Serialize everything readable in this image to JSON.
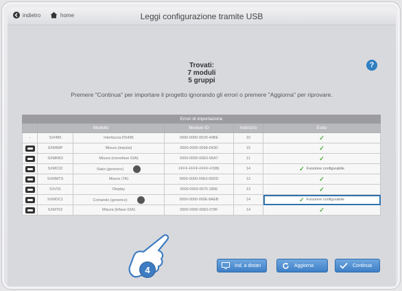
{
  "header": {
    "back_label": "indietro",
    "home_label": "home",
    "title": "Leggi configurazione tramite USB"
  },
  "summary": {
    "line1": "Trovati:",
    "line2": "7 moduli",
    "line3": "5 gruppi"
  },
  "help_label": "?",
  "message": "Premere \"Continua\" per importare il progetto ignorando gli errori o premere \"Aggiorna\" per riprovare.",
  "table": {
    "caption": "Errori di importazione",
    "headers": [
      "",
      "Modello",
      "",
      "Modulo ID",
      "Indirizzo",
      "Esito"
    ],
    "rows": [
      {
        "icon": "dash",
        "model": "SXI485",
        "desc": "Interfaccia RS485",
        "id": "0000-0000-001B-40BE",
        "addr": "10",
        "esito": ""
      },
      {
        "icon": "device",
        "model": "SXMIMP",
        "desc": "Misura (impulsi)",
        "id": "0000-0000-0058-043D",
        "addr": "15",
        "esito": ""
      },
      {
        "icon": "device",
        "model": "SXMM63",
        "desc": "Misura (monofase 63A)",
        "id": "0000-0000-00E0-06A7",
        "addr": "11",
        "esito": ""
      },
      {
        "icon": "device",
        "model": "SXMC02",
        "desc": "Stato (generico)",
        "id": "FFFF-FFFF-FFFF-FD86",
        "addr": "14",
        "esito": "Funzione configurabile"
      },
      {
        "icon": "device",
        "model": "SXMMTS",
        "desc": "Misure (TA)",
        "id": "0000-0000-00E0-06DD",
        "addr": "12",
        "esito": ""
      },
      {
        "icon": "device",
        "model": "SXV01",
        "desc": "Display",
        "id": "0000-0000-0076-186E",
        "addr": "13",
        "esito": ""
      },
      {
        "icon": "device",
        "model": "SXMOC1",
        "desc": "Comando (generico)",
        "id": "0000-0000-000E-8AEB",
        "addr": "14",
        "esito": "Funzione configurabile"
      },
      {
        "icon": "device",
        "model": "SXMT63",
        "desc": "Misura (trifase 63A)",
        "id": "0000-0000-00E0-078F",
        "addr": "14",
        "esito": ""
      }
    ]
  },
  "buttons": {
    "remote": "Ind. a distan",
    "update": "Aggiorna",
    "continue": "Continua"
  },
  "callout": "4",
  "colors": {
    "accent": "#3e7fc6",
    "ok": "#48a838",
    "highlight": "#2e73ad"
  }
}
